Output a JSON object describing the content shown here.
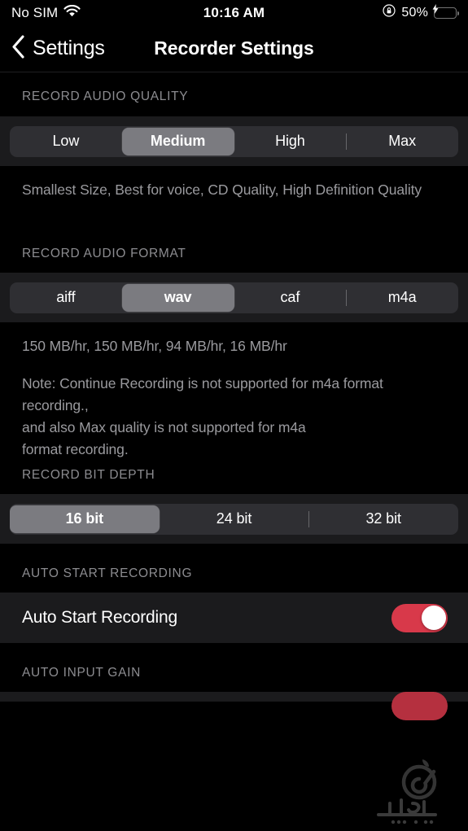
{
  "status_bar": {
    "carrier": "No SIM",
    "wifi_icon": "wifi-icon",
    "time": "10:16 AM",
    "rotation_lock_icon": "rotation-lock-icon",
    "battery_percent": "50%",
    "battery_icon": "battery-charging-icon",
    "battery_color": "#4cd662"
  },
  "nav": {
    "back_icon": "chevron-left-icon",
    "back_label": "Settings",
    "title": "Recorder Settings"
  },
  "sections": {
    "quality": {
      "header": "RECORD AUDIO QUALITY",
      "options": [
        "Low",
        "Medium",
        "High",
        "Max"
      ],
      "selected": "Medium",
      "selected_index": 1,
      "divider_before_index": 3,
      "description": "Smallest Size, Best for voice, CD Quality, High Definition Quality"
    },
    "format": {
      "header": "RECORD AUDIO FORMAT",
      "options": [
        "aiff",
        "wav",
        "caf",
        "m4a"
      ],
      "selected": "wav",
      "selected_index": 1,
      "divider_before_index": 3,
      "rates": "150 MB/hr, 150 MB/hr, 94 MB/hr, 16 MB/hr",
      "note": "Note: Continue Recording is not supported for m4a format recording.,\nand also Max quality is not supported for m4a\nformat recording."
    },
    "bit_depth": {
      "header": "RECORD BIT DEPTH",
      "options": [
        "16 bit",
        "24 bit",
        "32 bit"
      ],
      "selected": "16 bit",
      "selected_index": 0,
      "divider_before_index": 2
    },
    "auto_start": {
      "header": "AUTO START RECORDING",
      "label": "Auto Start Recording",
      "toggle_state": "on",
      "toggle_color": "#d8394a"
    },
    "auto_input_gain": {
      "header": "AUTO INPUT GAIN"
    }
  },
  "watermark": {
    "name": "sibche-watermark"
  }
}
